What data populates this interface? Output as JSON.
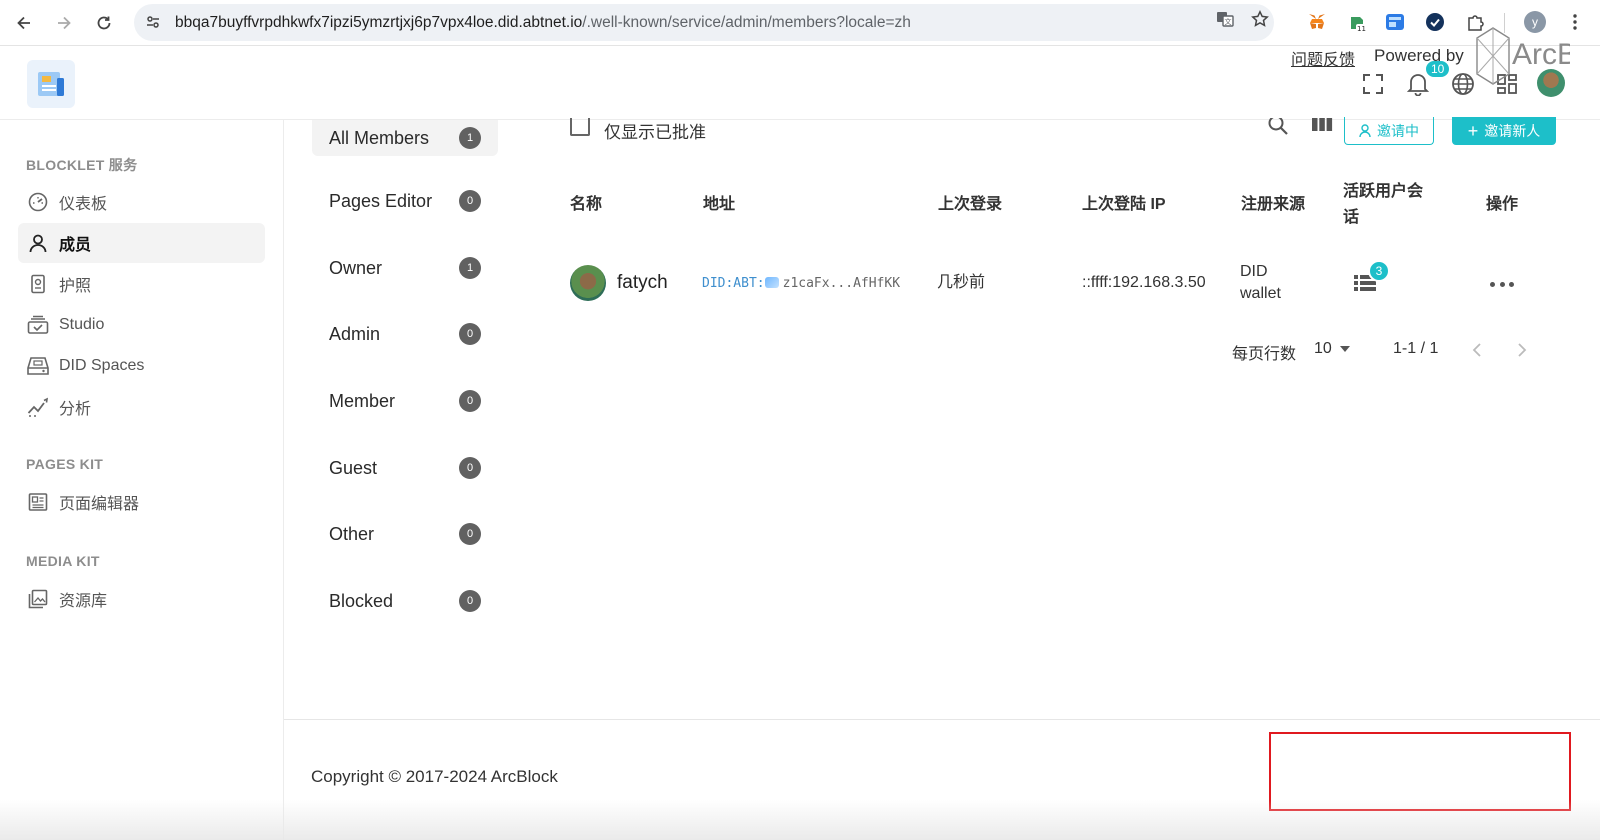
{
  "browser": {
    "url_host": "bbqa7buyffvrpdhkwfx7ipzi5ymzrtjxj6p7vpx4loe.did.abtnet.io",
    "url_path": "/.well-known/service/admin/members?locale=zh",
    "extension_badge": "11",
    "profile_initial": "y"
  },
  "header": {
    "notification_count": "10"
  },
  "sidebar": {
    "sections": [
      {
        "title": "BLOCKLET 服务",
        "items": [
          {
            "label": "仪表板",
            "icon": "dashboard-icon"
          },
          {
            "label": "成员",
            "icon": "person-icon",
            "active": true
          },
          {
            "label": "护照",
            "icon": "passport-icon"
          },
          {
            "label": "Studio",
            "icon": "studio-icon"
          },
          {
            "label": "DID Spaces",
            "icon": "drive-icon"
          },
          {
            "label": "分析",
            "icon": "analytics-icon"
          }
        ]
      },
      {
        "title": "PAGES KIT",
        "items": [
          {
            "label": "页面编辑器",
            "icon": "newspaper-icon"
          }
        ]
      },
      {
        "title": "MEDIA KIT",
        "items": [
          {
            "label": "资源库",
            "icon": "gallery-icon"
          }
        ]
      }
    ]
  },
  "roles": [
    {
      "name": "All Members",
      "count": "1",
      "active": true
    },
    {
      "name": "Pages Editor",
      "count": "0"
    },
    {
      "name": "Owner",
      "count": "1"
    },
    {
      "name": "Admin",
      "count": "0"
    },
    {
      "name": "Member",
      "count": "0"
    },
    {
      "name": "Guest",
      "count": "0"
    },
    {
      "name": "Other",
      "count": "0"
    },
    {
      "name": "Blocked",
      "count": "0"
    }
  ],
  "toolbar": {
    "approved_only_label": "仅显示已批准",
    "inviting_label": "邀请中",
    "invite_new_label": "邀请新人"
  },
  "table": {
    "columns": [
      "名称",
      "地址",
      "上次登录",
      "上次登陆 IP",
      "注册来源",
      "活跃用户会话",
      "操作"
    ],
    "rows": [
      {
        "name": "fatych",
        "did_prefix": "DID:ABT:",
        "did_short": "z1caFx...AfHfKK",
        "last_login": "几秒前",
        "last_ip": "::ffff:192.168.3.50",
        "source": "DID wallet",
        "sessions": "3"
      }
    ]
  },
  "pagination": {
    "rows_per_page_label": "每页行数",
    "rows_per_page": "10",
    "range": "1-1 / 1"
  },
  "footer": {
    "copyright": "Copyright © 2017-2024  ArcBlock",
    "feedback": "问题反馈",
    "powered_by": "Powered by",
    "brand": "ArcBlock"
  },
  "colors": {
    "accent": "#1dbfc9",
    "highlight_border": "#e0191f"
  }
}
